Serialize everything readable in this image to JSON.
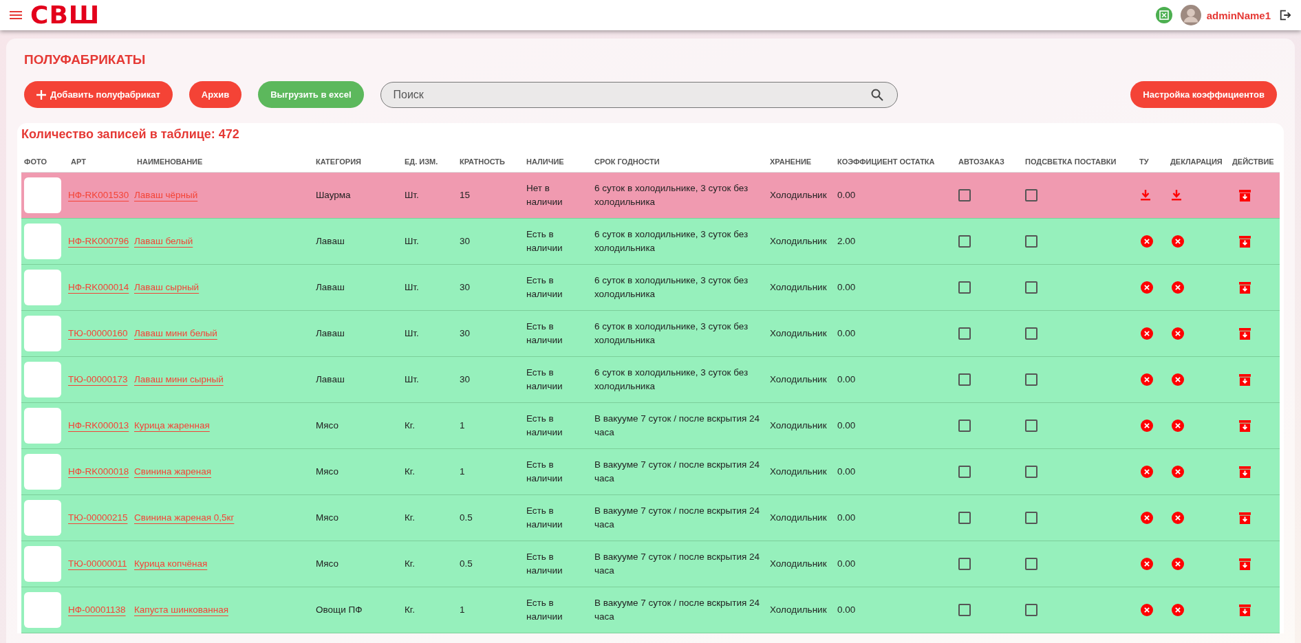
{
  "header": {
    "logo": "СВШ",
    "user_name": "adminName1"
  },
  "page": {
    "title": "ПОЛУФАБРИКАТЫ"
  },
  "toolbar": {
    "add_button": "Добавить полуфабрикат",
    "archive_button": "Архив",
    "export_button": "Выгрузить в excel",
    "search": {
      "placeholder": "Поиск"
    },
    "coefficients_button": "Настройка коэффициентов"
  },
  "table": {
    "count_label": "Количество записей в таблице: 472",
    "columns": [
      "ФОТО",
      "АРТ",
      "НАИМЕНОВАНИЕ",
      "КАТЕГОРИЯ",
      "ЕД. ИЗМ.",
      "КРАТНОСТЬ",
      "НАЛИЧИЕ",
      "СРОК ГОДНОСТИ",
      "ХРАНЕНИЕ",
      "КОЭФФИЦИЕНТ ОСТАТКА",
      "АВТОЗАКАЗ",
      "ПОДСВЕТКА ПОСТАВКИ",
      "ТУ",
      "ДЕКЛАРАЦИЯ",
      "ДЕЙСТВИЕ"
    ],
    "rows": [
      {
        "article": "НФ-RK001530",
        "name": "Лаваш чёрный",
        "category": "Шаурма",
        "unit": "Шт.",
        "multiplicity": "15",
        "in_stock": false,
        "availability": "Нет в наличии",
        "shelf_life": "6 суток в холодильнике, 3 суток без холодильника",
        "storage": "Холодильник",
        "coefficient": "0.00",
        "autoorder": false,
        "highlight": false,
        "tu": true,
        "declaration": true
      },
      {
        "article": "НФ-RK000796",
        "name": "Лаваш белый",
        "category": "Лаваш",
        "unit": "Шт.",
        "multiplicity": "30",
        "in_stock": true,
        "availability": "Есть в наличии",
        "shelf_life": "6 суток в холодильнике, 3 суток без холодильника",
        "storage": "Холодильник",
        "coefficient": "2.00",
        "autoorder": false,
        "highlight": false,
        "tu": false,
        "declaration": false
      },
      {
        "article": "НФ-RK000014",
        "name": "Лаваш сырный",
        "category": "Лаваш",
        "unit": "Шт.",
        "multiplicity": "30",
        "in_stock": true,
        "availability": "Есть в наличии",
        "shelf_life": "6 суток в холодильнике, 3 суток без холодильника",
        "storage": "Холодильник",
        "coefficient": "0.00",
        "autoorder": false,
        "highlight": false,
        "tu": false,
        "declaration": false
      },
      {
        "article": "ТЮ-00000160",
        "name": "Лаваш мини белый",
        "category": "Лаваш",
        "unit": "Шт.",
        "multiplicity": "30",
        "in_stock": true,
        "availability": "Есть в наличии",
        "shelf_life": "6 суток в холодильнике, 3 суток без холодильника",
        "storage": "Холодильник",
        "coefficient": "0.00",
        "autoorder": false,
        "highlight": false,
        "tu": false,
        "declaration": false
      },
      {
        "article": "ТЮ-00000173",
        "name": "Лаваш мини сырный",
        "category": "Лаваш",
        "unit": "Шт.",
        "multiplicity": "30",
        "in_stock": true,
        "availability": "Есть в наличии",
        "shelf_life": "6 суток в холодильнике, 3 суток без холодильника",
        "storage": "Холодильник",
        "coefficient": "0.00",
        "autoorder": false,
        "highlight": false,
        "tu": false,
        "declaration": false
      },
      {
        "article": "НФ-RK000013",
        "name": "Курица жаренная",
        "category": "Мясо",
        "unit": "Кг.",
        "multiplicity": "1",
        "in_stock": true,
        "availability": "Есть в наличии",
        "shelf_life": "В вакууме 7 суток / после вскрытия 24 часа",
        "storage": "Холодильник",
        "coefficient": "0.00",
        "autoorder": false,
        "highlight": false,
        "tu": false,
        "declaration": false
      },
      {
        "article": "НФ-RK000018",
        "name": "Свинина жареная",
        "category": "Мясо",
        "unit": "Кг.",
        "multiplicity": "1",
        "in_stock": true,
        "availability": "Есть в наличии",
        "shelf_life": "В вакууме 7 суток / после вскрытия 24 часа",
        "storage": "Холодильник",
        "coefficient": "0.00",
        "autoorder": false,
        "highlight": false,
        "tu": false,
        "declaration": false
      },
      {
        "article": "ТЮ-00000215",
        "name": "Свинина жареная 0,5кг",
        "category": "Мясо",
        "unit": "Кг.",
        "multiplicity": "0.5",
        "in_stock": true,
        "availability": "Есть в наличии",
        "shelf_life": "В вакууме 7 суток / после вскрытия 24 часа",
        "storage": "Холодильник",
        "coefficient": "0.00",
        "autoorder": false,
        "highlight": false,
        "tu": false,
        "declaration": false
      },
      {
        "article": "ТЮ-00000011",
        "name": "Курица копчёная",
        "category": "Мясо",
        "unit": "Кг.",
        "multiplicity": "0.5",
        "in_stock": true,
        "availability": "Есть в наличии",
        "shelf_life": "В вакууме 7 суток / после вскрытия 24 часа",
        "storage": "Холодильник",
        "coefficient": "0.00",
        "autoorder": false,
        "highlight": false,
        "tu": false,
        "declaration": false
      },
      {
        "article": "НФ-00001138",
        "name": "Капуста шинкованная",
        "category": "Овощи ПФ",
        "unit": "Кг.",
        "multiplicity": "1",
        "in_stock": true,
        "availability": "Есть в наличии",
        "shelf_life": "В вакууме 7 суток / после вскрытия 24 часа",
        "storage": "Холодильник",
        "coefficient": "0.00",
        "autoorder": false,
        "highlight": false,
        "tu": false,
        "declaration": false
      }
    ]
  }
}
